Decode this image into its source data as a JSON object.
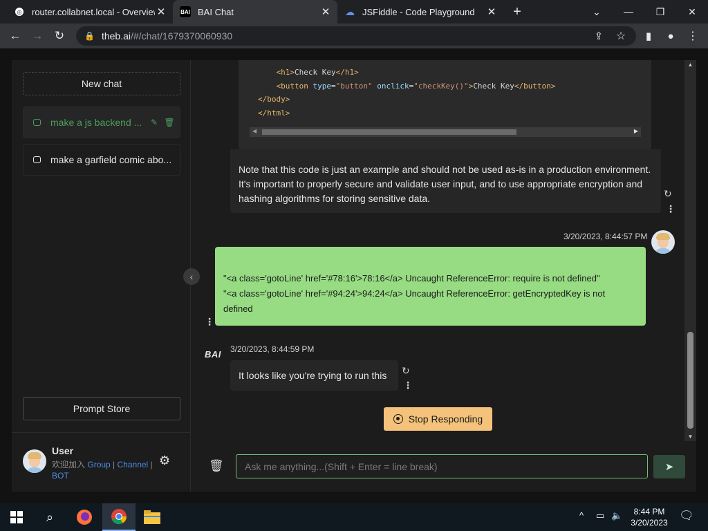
{
  "browser": {
    "tabs": [
      {
        "title": "router.collabnet.local - Overview"
      },
      {
        "title": "BAI Chat"
      },
      {
        "title": "JSFiddle - Code Playground"
      }
    ],
    "address_host": "theb.ai",
    "address_path": "/#/chat/1679370060930",
    "icons": {
      "back": "←",
      "forward": "→",
      "reload": "↻",
      "lock": "🔒",
      "new_tab": "+"
    }
  },
  "sidebar": {
    "new_chat": "New chat",
    "chats": [
      {
        "title": "make a js backend ..."
      },
      {
        "title": "make a garfield comic abo..."
      }
    ],
    "prompt_store": "Prompt Store",
    "user": {
      "name": "User",
      "join_text": "欢迎加入",
      "links": [
        "Group",
        "Channel",
        "BOT"
      ],
      "separator": " | "
    }
  },
  "chat": {
    "code_lines": [
      {
        "indent": "    ",
        "parts": [
          {
            "c": "tag",
            "t": "<h1>"
          },
          {
            "c": "",
            "t": "Check Key"
          },
          {
            "c": "tag",
            "t": "</h1>"
          }
        ]
      },
      {
        "indent": "    ",
        "parts": [
          {
            "c": "tag",
            "t": "<button "
          },
          {
            "c": "attr",
            "t": "type"
          },
          {
            "c": "",
            "t": "="
          },
          {
            "c": "str",
            "t": "\"button\""
          },
          {
            "c": "",
            "t": " "
          },
          {
            "c": "attr",
            "t": "onclick"
          },
          {
            "c": "",
            "t": "="
          },
          {
            "c": "str",
            "t": "\"checkKey()\""
          },
          {
            "c": "tag",
            "t": ">"
          },
          {
            "c": "",
            "t": "Check Key"
          },
          {
            "c": "tag",
            "t": "</button>"
          }
        ]
      },
      {
        "indent": "",
        "parts": [
          {
            "c": "tag",
            "t": "</body>"
          }
        ]
      },
      {
        "indent": "",
        "parts": [
          {
            "c": "tag",
            "t": "</html>"
          }
        ]
      }
    ],
    "note": "Note that this code is just an example and should not be used as-is in a production environment. It's important to properly secure and validate user input, and to use appropriate encryption and hashing algorithms for storing sensitive data.",
    "user_timestamp": "3/20/2023, 8:44:57 PM",
    "user_message_line1": "\"<a class='gotoLine' href='#78:16'>78:16</a> Uncaught ReferenceError: require is not defined\"",
    "user_message_line2": "\"<a class='gotoLine' href='#94:24'>94:24</a> Uncaught ReferenceError: getEncryptedKey is not defined",
    "bot_label": "BAI",
    "bot_timestamp": "3/20/2023, 8:44:59 PM",
    "bot_reply": "It looks like you're trying to run this",
    "stop_button": "Stop Responding",
    "input_placeholder": "Ask me anything...(Shift + Enter = line break)"
  },
  "taskbar": {
    "time": "8:44 PM",
    "date": "3/20/2023"
  },
  "colors": {
    "accent_green": "#97db83",
    "stop_button": "#f4c27a",
    "link_blue": "#4d8ee8"
  }
}
